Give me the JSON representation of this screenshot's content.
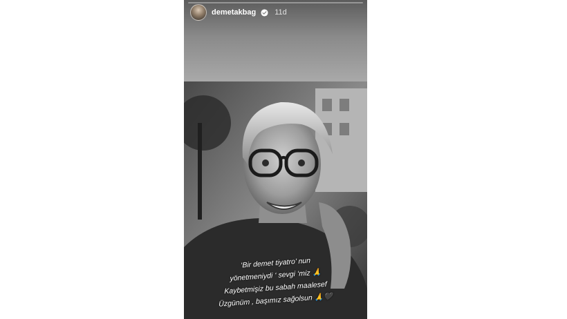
{
  "story": {
    "username": "demetakbag",
    "time_ago": "11d",
    "progress": 0.0,
    "verified": true,
    "icons": {
      "verified": "verified-badge-icon",
      "avatar": "profile-avatar"
    },
    "caption_lines": [
      "‘Bir demet tiyatro’ nun",
      "yönetmeniydi ‘ sevgi ‘miz 🙏",
      "Kaybetmişiz bu sabah maalesef",
      "Üzgünüm , başımız sağolsun 🙏🖤"
    ]
  }
}
